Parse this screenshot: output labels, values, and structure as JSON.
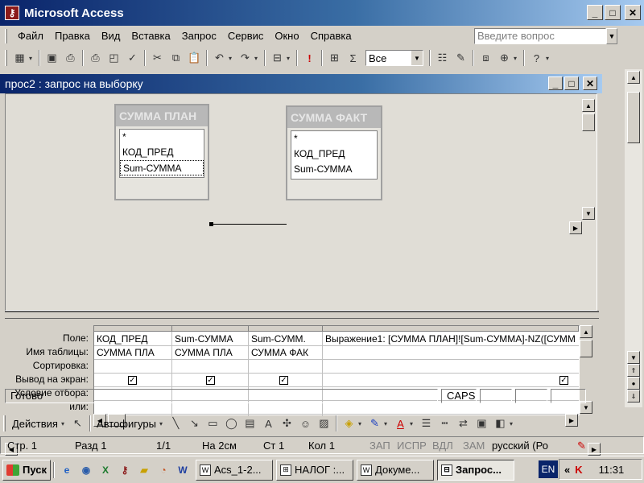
{
  "app": {
    "title": "Microsoft Access",
    "icon": "access-key-icon"
  },
  "menu": [
    "Файл",
    "Правка",
    "Вид",
    "Вставка",
    "Запрос",
    "Сервис",
    "Окно",
    "Справка"
  ],
  "ask_box": {
    "placeholder": "Введите вопрос"
  },
  "toolbar": {
    "top_values": "Все",
    "icons": [
      "view-icon",
      "save-icon",
      "print-preview-icon",
      "print-icon",
      "preview-icon",
      "spelling-icon",
      "cut-icon",
      "copy-icon",
      "paste-icon",
      "undo-icon",
      "redo-icon",
      "query-type-icon",
      "run-icon",
      "show-table-icon",
      "totals-icon",
      "properties-icon",
      "build-icon",
      "database-window-icon",
      "new-object-icon",
      "help-icon"
    ]
  },
  "query_window": {
    "title": "прос2 : запрос на выборку",
    "tables": [
      {
        "name": "СУММА ПЛАН",
        "fields": [
          "*",
          "КОД_ПРЕД",
          "Sum-СУММА"
        ]
      },
      {
        "name": "СУММА ФАКТ",
        "fields": [
          "*",
          "КОД_ПРЕД",
          "Sum-СУММА"
        ]
      }
    ],
    "grid": {
      "row_labels": [
        "Поле:",
        "Имя таблицы:",
        "Сортировка:",
        "Вывод на экран:",
        "Условие отбора:",
        "или:"
      ],
      "columns": [
        {
          "field": "КОД_ПРЕД",
          "table": "СУММА ПЛА",
          "show": true
        },
        {
          "field": "Sum-СУММА",
          "table": "СУММА ПЛА",
          "show": true
        },
        {
          "field": "Sum-СУММ.",
          "table": "СУММА ФАК",
          "show": true
        },
        {
          "field": "Выражение1: [СУММА ПЛАН]![Sum-СУММА]-NZ([СУММ",
          "table": "",
          "show": true
        }
      ]
    }
  },
  "status": {
    "text": "Готово",
    "caps": "CAPS"
  },
  "draw_toolbar": {
    "actions": "Действия",
    "autoshapes": "Автофигуры"
  },
  "word_status": {
    "page": "Стр. 1",
    "section": "Разд 1",
    "pages": "1/1",
    "at": "На 2см",
    "line": "Ст 1",
    "col": "Кол 1",
    "rec": "ЗАП",
    "trk": "ИСПР",
    "ext": "ВДЛ",
    "ovr": "ЗАМ",
    "lang": "русский (Ро"
  },
  "taskbar": {
    "start": "Пуск",
    "tasks": [
      {
        "label": "Acs_1-2...",
        "icon": "word-icon"
      },
      {
        "label": "НАЛОГ :...",
        "icon": "access-icon"
      },
      {
        "label": "Докуме...",
        "icon": "word-icon"
      },
      {
        "label": "Запрос...",
        "icon": "query-icon",
        "active": true
      }
    ],
    "lang": "EN",
    "clock": "11:31"
  }
}
